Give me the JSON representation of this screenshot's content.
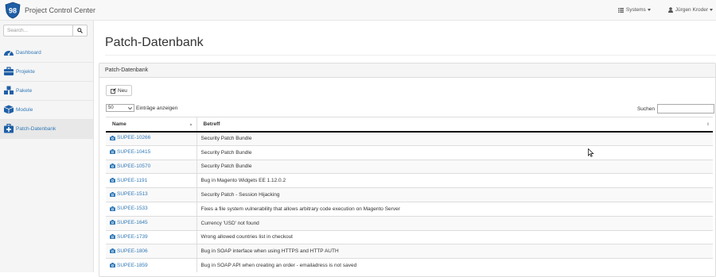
{
  "navbar": {
    "logo_text": "98",
    "title": "Project Control Center",
    "systems_label": "Systems",
    "user_label": "Jürgen Kroder"
  },
  "sidebar": {
    "search_placeholder": "Search...",
    "items": [
      {
        "label": "Dashboard",
        "icon": "dashboard-icon"
      },
      {
        "label": "Projekte",
        "icon": "briefcase-icon"
      },
      {
        "label": "Pakete",
        "icon": "cubes-icon"
      },
      {
        "label": "Module",
        "icon": "cube-icon"
      },
      {
        "label": "Patch-Datenbank",
        "icon": "medkit-icon",
        "active": true
      }
    ]
  },
  "main": {
    "page_title": "Patch-Datenbank",
    "panel_heading": "Patch-Datenbank",
    "new_button": "Neu",
    "length_value": "50",
    "length_label": "Einträge anzeigen",
    "search_label": "Suchen",
    "table": {
      "columns": [
        "Name",
        "Betreff"
      ],
      "rows": [
        {
          "name": "SUPEE-10266",
          "subject": "Security Patch Bundle"
        },
        {
          "name": "SUPEE-10415",
          "subject": "Security Patch Bundle"
        },
        {
          "name": "SUPEE-10570",
          "subject": "Security Patch Bundle"
        },
        {
          "name": "SUPEE-1191",
          "subject": "Bug in Magento Widgets EE 1.12.0.2"
        },
        {
          "name": "SUPEE-1513",
          "subject": "Security Patch - Session Hijacking"
        },
        {
          "name": "SUPEE-1533",
          "subject": "Fixes a file system vulnerability that allows arbitrary code execution on Magento Server"
        },
        {
          "name": "SUPEE-1645",
          "subject": "Currency 'USD' not found"
        },
        {
          "name": "SUPEE-1739",
          "subject": "Wrong allowed countries list in checkout"
        },
        {
          "name": "SUPEE-1806",
          "subject": "Bug in SOAP interface when using HTTPS and HTTP AUTH"
        },
        {
          "name": "SUPEE-1859",
          "subject": "Bug in SOAP API when creating an order - emailadress is not saved"
        }
      ]
    }
  },
  "colors": {
    "link": "#337ab7",
    "logo_blue": "#1f5fa6",
    "navbar_bg": "#f8f8f8",
    "sidebar_bg": "#f5f5f5"
  }
}
